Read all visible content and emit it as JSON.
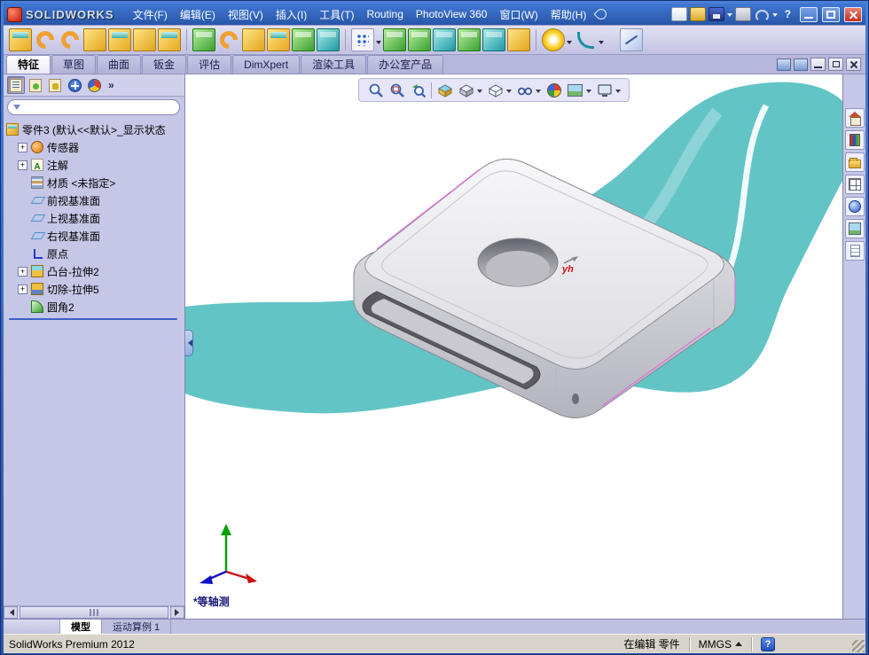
{
  "titlebar": {
    "app_name": "SOLIDWORKS",
    "menus": [
      "文件(F)",
      "编辑(E)",
      "视图(V)",
      "插入(I)",
      "工具(T)",
      "Routing",
      "PhotoView 360",
      "窗口(W)",
      "帮助(H)"
    ]
  },
  "icons": {
    "chevron_more": "»",
    "help_glyph": "?",
    "annotation_glyph": "A",
    "plus_glyph": "+"
  },
  "command_tabs": [
    {
      "label": "特征"
    },
    {
      "label": "草图"
    },
    {
      "label": "曲面"
    },
    {
      "label": "钣金"
    },
    {
      "label": "评估"
    },
    {
      "label": "DimXpert"
    },
    {
      "label": "渲染工具"
    },
    {
      "label": "办公室产品"
    }
  ],
  "feature_tree": {
    "root": "零件3 (默认<<默认>_显示状态",
    "items": [
      {
        "label": "传感器"
      },
      {
        "label": "注解"
      },
      {
        "label": "材质 <未指定>"
      },
      {
        "label": "前视基准面"
      },
      {
        "label": "上视基准面"
      },
      {
        "label": "右视基准面"
      },
      {
        "label": "原点"
      },
      {
        "label": "凸台-拉伸2"
      },
      {
        "label": "切除-拉伸5"
      },
      {
        "label": "圆角2"
      }
    ]
  },
  "viewport": {
    "view_label": "*等轴测",
    "watermark": "yh"
  },
  "bottom_tabs": [
    {
      "label": "模型"
    },
    {
      "label": "运动算例 1"
    }
  ],
  "statusbar": {
    "product": "SolidWorks Premium 2012",
    "editing": "在编辑 零件",
    "units": "MMGS"
  },
  "colors": {
    "titlebar_blue": "#2e62b8",
    "panel_lavender": "#c6c6e7",
    "splash_teal": "#63c4c6"
  }
}
